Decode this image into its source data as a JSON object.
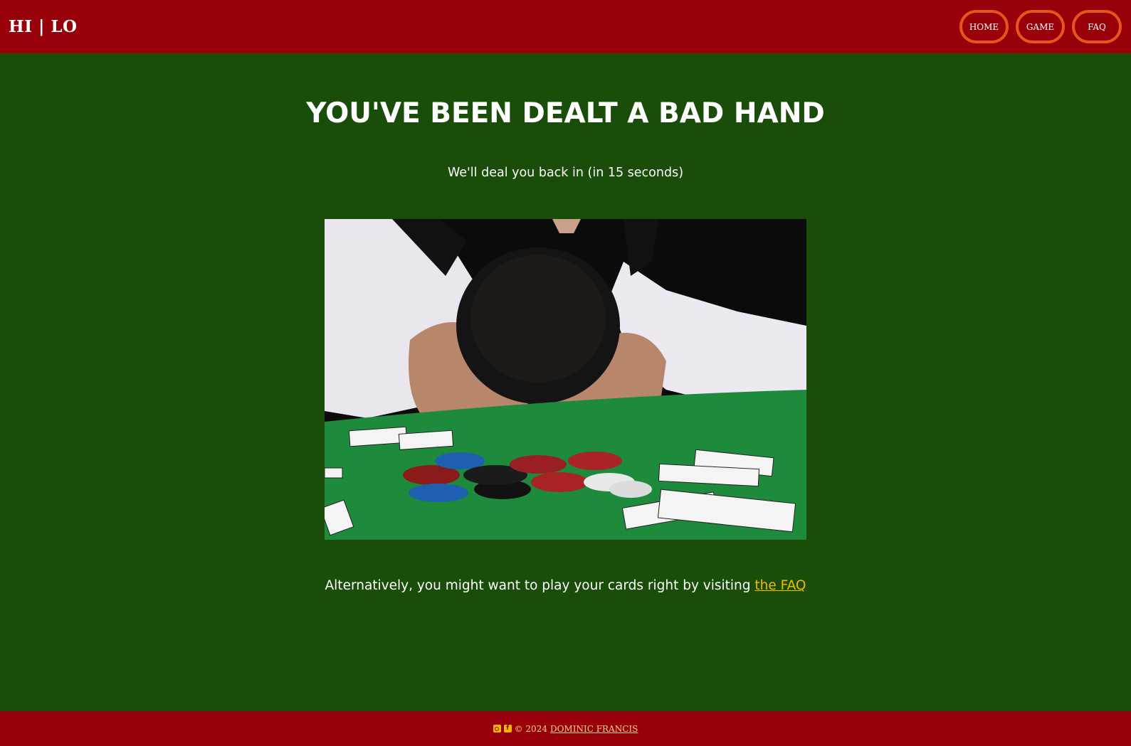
{
  "header": {
    "brand": "HI | LO",
    "nav": [
      {
        "label": "HOME"
      },
      {
        "label": "GAME"
      },
      {
        "label": "FAQ"
      }
    ]
  },
  "main": {
    "title": "YOU'VE BEEN DEALT A BAD HAND",
    "subtitle": "We'll deal you back in (in 15 seconds)",
    "alt_prefix": "Alternatively, you might want to play your cards right by visiting ",
    "alt_link": "the FAQ"
  },
  "footer": {
    "icons": [
      "instagram-icon",
      "facebook-icon"
    ],
    "copyright": "© 2024",
    "author_link": "DOMINIC FRANCIS"
  },
  "colors": {
    "background": "#1a4d0a",
    "header_footer": "#98000a",
    "nav_border": "#e4561b",
    "link": "#f5b800"
  }
}
